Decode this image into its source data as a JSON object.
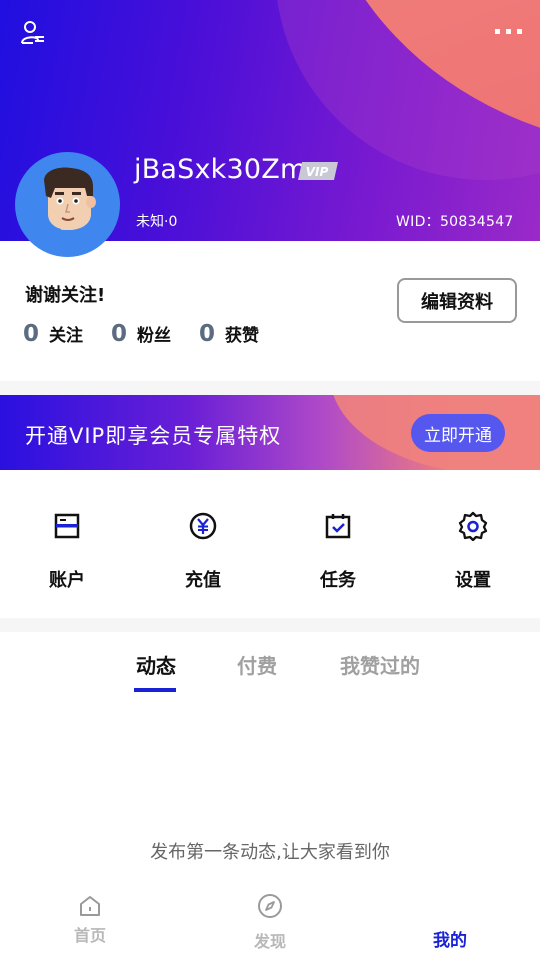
{
  "header": {
    "username": "jBaSxk30Zm",
    "vip_badge": "VIP",
    "gender": "未知·0",
    "wid": "WID：50834547"
  },
  "profile": {
    "bio": "谢谢关注!",
    "edit_button": "编辑资料",
    "stats": [
      {
        "value": "0",
        "label": "关注"
      },
      {
        "value": "0",
        "label": "粉丝"
      },
      {
        "value": "0",
        "label": "获赞"
      }
    ]
  },
  "vip_banner": {
    "text": "开通VIP即享会员专属特权",
    "button": "立即开通"
  },
  "actions": [
    {
      "label": "账户",
      "icon": "wallet-icon"
    },
    {
      "label": "充值",
      "icon": "yuan-coin-icon"
    },
    {
      "label": "任务",
      "icon": "calendar-check-icon"
    },
    {
      "label": "设置",
      "icon": "gear-icon"
    }
  ],
  "tabs": [
    {
      "label": "动态",
      "active": true
    },
    {
      "label": "付费",
      "active": false
    },
    {
      "label": "我赞过的",
      "active": false
    }
  ],
  "empty_message": "发布第一条动态,让大家看到你",
  "bottom_nav": [
    {
      "label": "首页",
      "icon": "home-icon",
      "active": false
    },
    {
      "label": "发现",
      "icon": "compass-icon",
      "active": false
    },
    {
      "label": "我的",
      "icon": "",
      "active": true
    }
  ],
  "colors": {
    "accent": "#1a22d6",
    "vip_button": "#5557ef",
    "avatar_bg": "#3f86ef",
    "header_gradient_start": "#1f0fe0",
    "header_blob": "#ef7a78"
  }
}
